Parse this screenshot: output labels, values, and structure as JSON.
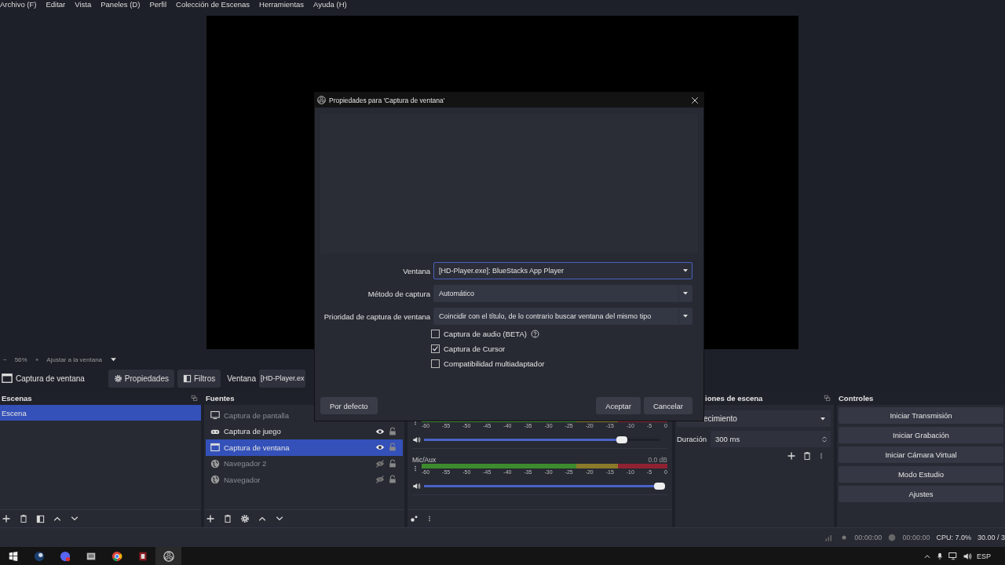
{
  "menu": [
    "Archivo (F)",
    "Editar",
    "Vista",
    "Paneles (D)",
    "Perfil",
    "Colección de Escenas",
    "Herramientas",
    "Ayuda (H)"
  ],
  "zoom_bar": {
    "zoom_out": "−",
    "zoom": "56%",
    "zoom_in": "+",
    "fit": "Ajustar a la ventana"
  },
  "source_toolbar": {
    "source_name": "Captura de ventana",
    "buttons": [
      {
        "label": "Propiedades",
        "kind": "gear"
      },
      {
        "label": "Filtros",
        "kind": "filter"
      }
    ],
    "field_label": "Ventana",
    "field_value": "[HD-Player.ex"
  },
  "scenes": {
    "title": "Escenas",
    "items": [
      {
        "name": "Escena",
        "selected": true
      }
    ]
  },
  "sources": {
    "title": "Fuentes",
    "items": [
      {
        "name": "Captura de pantalla",
        "kind": "monitor",
        "selected": false,
        "visible": false
      },
      {
        "name": "Captura de juego",
        "kind": "gamepad",
        "selected": false,
        "visible": true,
        "locked": false
      },
      {
        "name": "Captura de ventana",
        "kind": "window",
        "selected": true,
        "visible": true,
        "locked": false
      },
      {
        "name": "Navegador 2",
        "kind": "globe",
        "selected": false,
        "visible": false,
        "locked": false
      },
      {
        "name": "Navegador",
        "kind": "globe",
        "selected": false,
        "visible": false,
        "locked": false
      }
    ]
  },
  "mixer": {
    "channels": [
      {
        "scale": [
          "-60",
          "-55",
          "-50",
          "-45",
          "-40",
          "-35",
          "-30",
          "-25",
          "-20",
          "-15",
          "-10",
          "-5",
          "0"
        ],
        "level": 0.84
      },
      {
        "name": "Mic/Aux",
        "reading": "0.0 dB",
        "scale": [
          "-60",
          "-55",
          "-50",
          "-45",
          "-40",
          "-35",
          "-30",
          "-25",
          "-20",
          "-15",
          "-10",
          "-5",
          "0"
        ],
        "level": 1
      }
    ]
  },
  "transitions": {
    "title": "iones de escena",
    "transition": "ecimiento",
    "duration_label": "Duración",
    "duration": "300 ms"
  },
  "controls": {
    "title": "Controles",
    "buttons": [
      "Iniciar Transmisión",
      "Iniciar Grabación",
      "Iniciar Cámara Virtual",
      "Modo Estudio",
      "Ajustes"
    ]
  },
  "status_bar": {
    "stream_time": "00:00:00",
    "record_time": "00:00:00",
    "cpu": "CPU: 7.0%",
    "fps": "30.00 / 3"
  },
  "taskbar": {
    "language": "ESP"
  },
  "dialog": {
    "title": "Propiedades para 'Captura de ventana'",
    "fields": [
      {
        "label": "Ventana",
        "value": "[HD-Player.exe]: BlueStacks App Player",
        "focused": true
      },
      {
        "label": "Método de captura",
        "value": "Automático",
        "focused": false
      },
      {
        "label": "Prioridad de captura de ventana",
        "value": "Coincidir con el título, de lo contrario buscar ventana del mismo tipo",
        "focused": false
      }
    ],
    "checkboxes": [
      {
        "label": "Captura de audio (BETA)",
        "checked": false,
        "help": true
      },
      {
        "label": "Captura de Cursor",
        "checked": true,
        "help": false
      },
      {
        "label": "Compatibilidad multiadaptador",
        "checked": false,
        "help": false
      }
    ],
    "default_button": "Por defecto",
    "buttons": [
      "Aceptar",
      "Cancelar"
    ]
  }
}
